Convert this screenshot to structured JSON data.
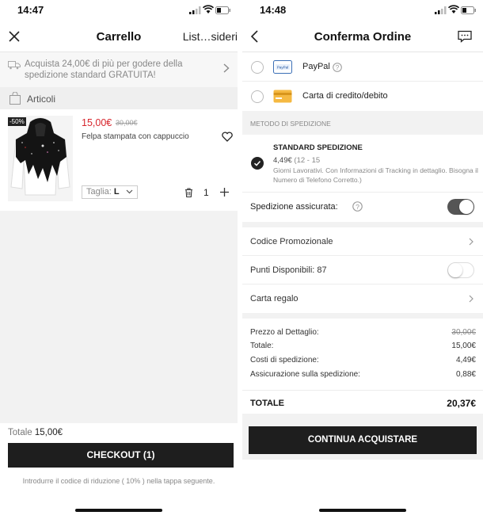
{
  "left": {
    "status": {
      "time": "14:47"
    },
    "nav": {
      "title": "Carrello",
      "right_link": "List…sideri",
      "close_icon": "close-icon"
    },
    "promo": {
      "text": "Acquista 24,00€ di più per godere della spedizione standard GRATUITA!"
    },
    "articles_label": "Articoli",
    "item": {
      "discount": "-50%",
      "price": "15,00€",
      "old_price": "30,00€",
      "name": "Felpa stampata con cappuccio",
      "size_label": "Taglia:",
      "size_value": "L",
      "quantity": "1"
    },
    "footer": {
      "total_label": "Totale",
      "total_value": "15,00€",
      "checkout_label": "CHECKOUT (1)",
      "note": "Introdurre il codice di riduzione ( 10% ) nella tappa seguente."
    }
  },
  "right": {
    "status": {
      "time": "14:48"
    },
    "nav": {
      "title": "Conferma Ordine"
    },
    "payment": {
      "paypal": "PayPal",
      "card": "Carta di credito/debito"
    },
    "shipping_head": "METODO DI SPEDIZIONE",
    "shipping": {
      "name": "STANDARD SPEDIZIONE",
      "price": "4,49€",
      "days": "(12 - 15",
      "desc": "Giorni Lavorativi. Con Informazioni di Tracking in dettaglio. Bisogna il Numero di Telefono Corretto.)"
    },
    "insured": {
      "label": "Spedizione assicurata:",
      "enabled": true
    },
    "options": {
      "promo_code": "Codice Promozionale",
      "points": "Punti Disponibili: 87",
      "points_enabled": false,
      "gift_card": "Carta regalo"
    },
    "summary": {
      "retail_label": "Prezzo al Dettaglio:",
      "retail_value": "30,00€",
      "total_label": "Totale:",
      "total_value": "15,00€",
      "shipping_label": "Costi di spedizione:",
      "shipping_value": "4,49€",
      "insurance_label": "Assicurazione sulla spedizione:",
      "insurance_value": "0,88€",
      "grand_label": "TOTALE",
      "grand_value": "20,37€"
    },
    "continue_label": "CONTINUA ACQUISTARE"
  },
  "colors": {
    "sale_red": "#d7262d",
    "button_dark": "#1e1e1e",
    "toggle_on": "#555555"
  }
}
